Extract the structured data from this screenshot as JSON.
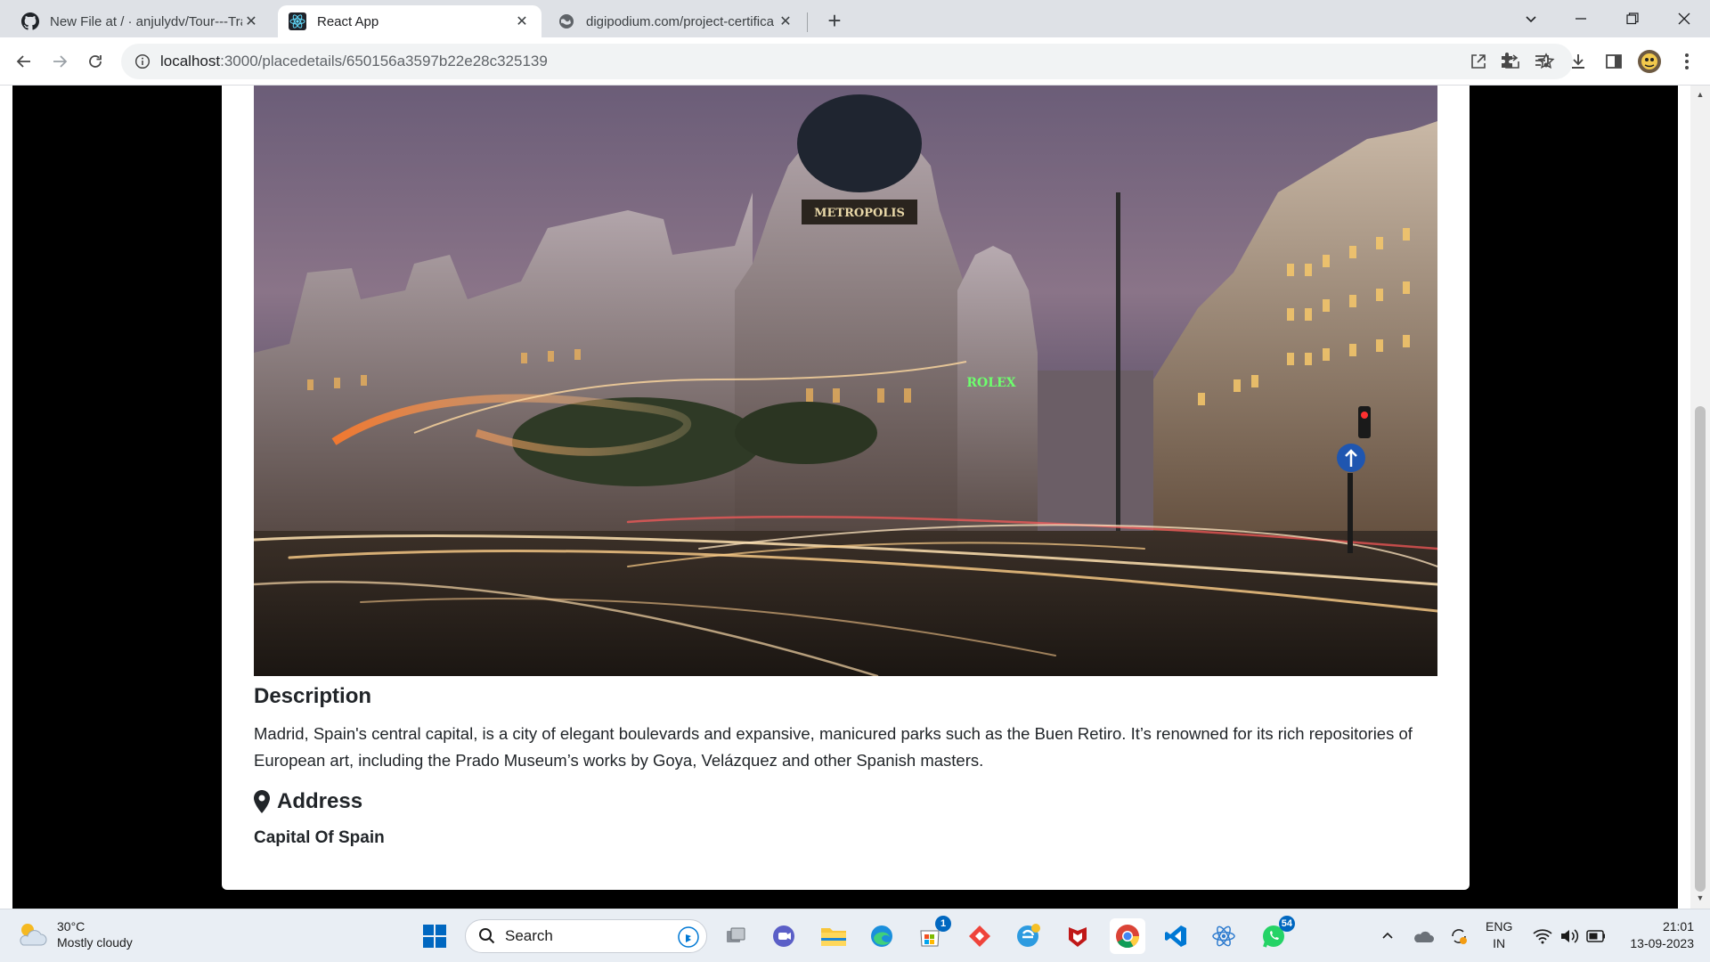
{
  "browser": {
    "tabs": [
      {
        "title": "New File at / · anjulydv/Tour---Tra",
        "favicon": "github-icon",
        "active": false
      },
      {
        "title": "React App",
        "favicon": "react-icon",
        "active": true
      },
      {
        "title": "digipodium.com/project-certifica",
        "favicon": "globe-icon",
        "active": false
      }
    ],
    "url_host": "localhost",
    "url_path": ":3000/placedetails/650156a3597b22e28c325139"
  },
  "page": {
    "hero_alt": "Madrid Gran Via night street with Metropolis building and light trails",
    "hero_signs": {
      "building_sign": "METROPOLIS",
      "neon_sign": "ROLEX"
    },
    "description_heading": "Description",
    "description_text": "Madrid, Spain's central capital, is a city of elegant boulevards and expansive, manicured parks such as the Buen Retiro. It’s renowned for its rich repositories of European art, including the Prado Museum’s works by Goya, Velázquez and other Spanish masters.",
    "address_heading": "Address",
    "address_text": "Capital Of Spain"
  },
  "taskbar": {
    "weather_temp": "30°C",
    "weather_desc": "Mostly cloudy",
    "search_label": "Search",
    "store_badge": "1",
    "whatsapp_badge": "54",
    "lang_line1": "ENG",
    "lang_line2": "IN",
    "time": "21:01",
    "date": "13-09-2023"
  },
  "colors": {
    "accent_windows": "#0067c0",
    "page_background": "#000000",
    "card_background": "#ffffff",
    "text": "#212529"
  }
}
